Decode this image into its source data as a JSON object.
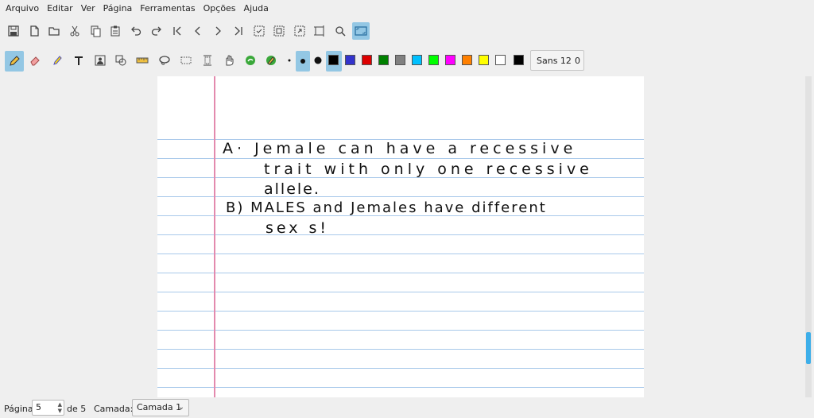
{
  "menu": [
    "Arquivo",
    "Editar",
    "Ver",
    "Página",
    "Ferramentas",
    "Opções",
    "Ajuda"
  ],
  "toolbar_main": [
    {
      "icon": "save-icon"
    },
    {
      "icon": "new-document-icon"
    },
    {
      "icon": "open-folder-icon"
    },
    {
      "icon": "cut-icon"
    },
    {
      "icon": "copy-icon"
    },
    {
      "icon": "paste-icon"
    },
    {
      "icon": "undo-icon"
    },
    {
      "icon": "redo-icon"
    },
    {
      "icon": "first-page-icon"
    },
    {
      "icon": "previous-page-icon"
    },
    {
      "icon": "next-page-icon"
    },
    {
      "icon": "last-page-icon"
    },
    {
      "icon": "zoom-fit-icon"
    },
    {
      "icon": "zoom-width-icon"
    },
    {
      "icon": "zoom-select-icon"
    },
    {
      "icon": "fullscreen-icon"
    },
    {
      "icon": "zoom-icon"
    },
    {
      "icon": "presentation-icon"
    }
  ],
  "toolbar_tools": [
    {
      "icon": "pen-icon",
      "active": true
    },
    {
      "icon": "eraser-icon"
    },
    {
      "icon": "highlighter-icon"
    },
    {
      "icon": "text-icon"
    },
    {
      "icon": "image-icon"
    },
    {
      "icon": "shapes-icon"
    },
    {
      "icon": "ruler-icon"
    },
    {
      "icon": "lasso-icon"
    },
    {
      "icon": "rect-select-icon"
    },
    {
      "icon": "vertical-space-icon"
    },
    {
      "icon": "hand-icon"
    },
    {
      "icon": "shape-recognizer-icon"
    },
    {
      "icon": "default-tool-icon"
    }
  ],
  "pen_sizes": [
    "fine",
    "medium",
    "thick"
  ],
  "colors": [
    "#000000",
    "#3333cc",
    "#dd0000",
    "#008000",
    "#808080",
    "#00c0ff",
    "#00ff00",
    "#ff00ff",
    "#ff8000",
    "#ffff00",
    "#ffffff"
  ],
  "selected_color": "#000000",
  "font_button": {
    "name": "Sans 12",
    "size": "0"
  },
  "handwriting": [
    "A· Jemale  can have  a recessive",
    "trait  with  only  one recessive",
    "allele.",
    "B)  MALES and  Jemales  have different",
    "sex  s!"
  ],
  "status": {
    "page_label": "Página",
    "page_value": "5",
    "page_total": "de 5",
    "layer_label": "Camada:",
    "layer_value": "Camada 1"
  }
}
